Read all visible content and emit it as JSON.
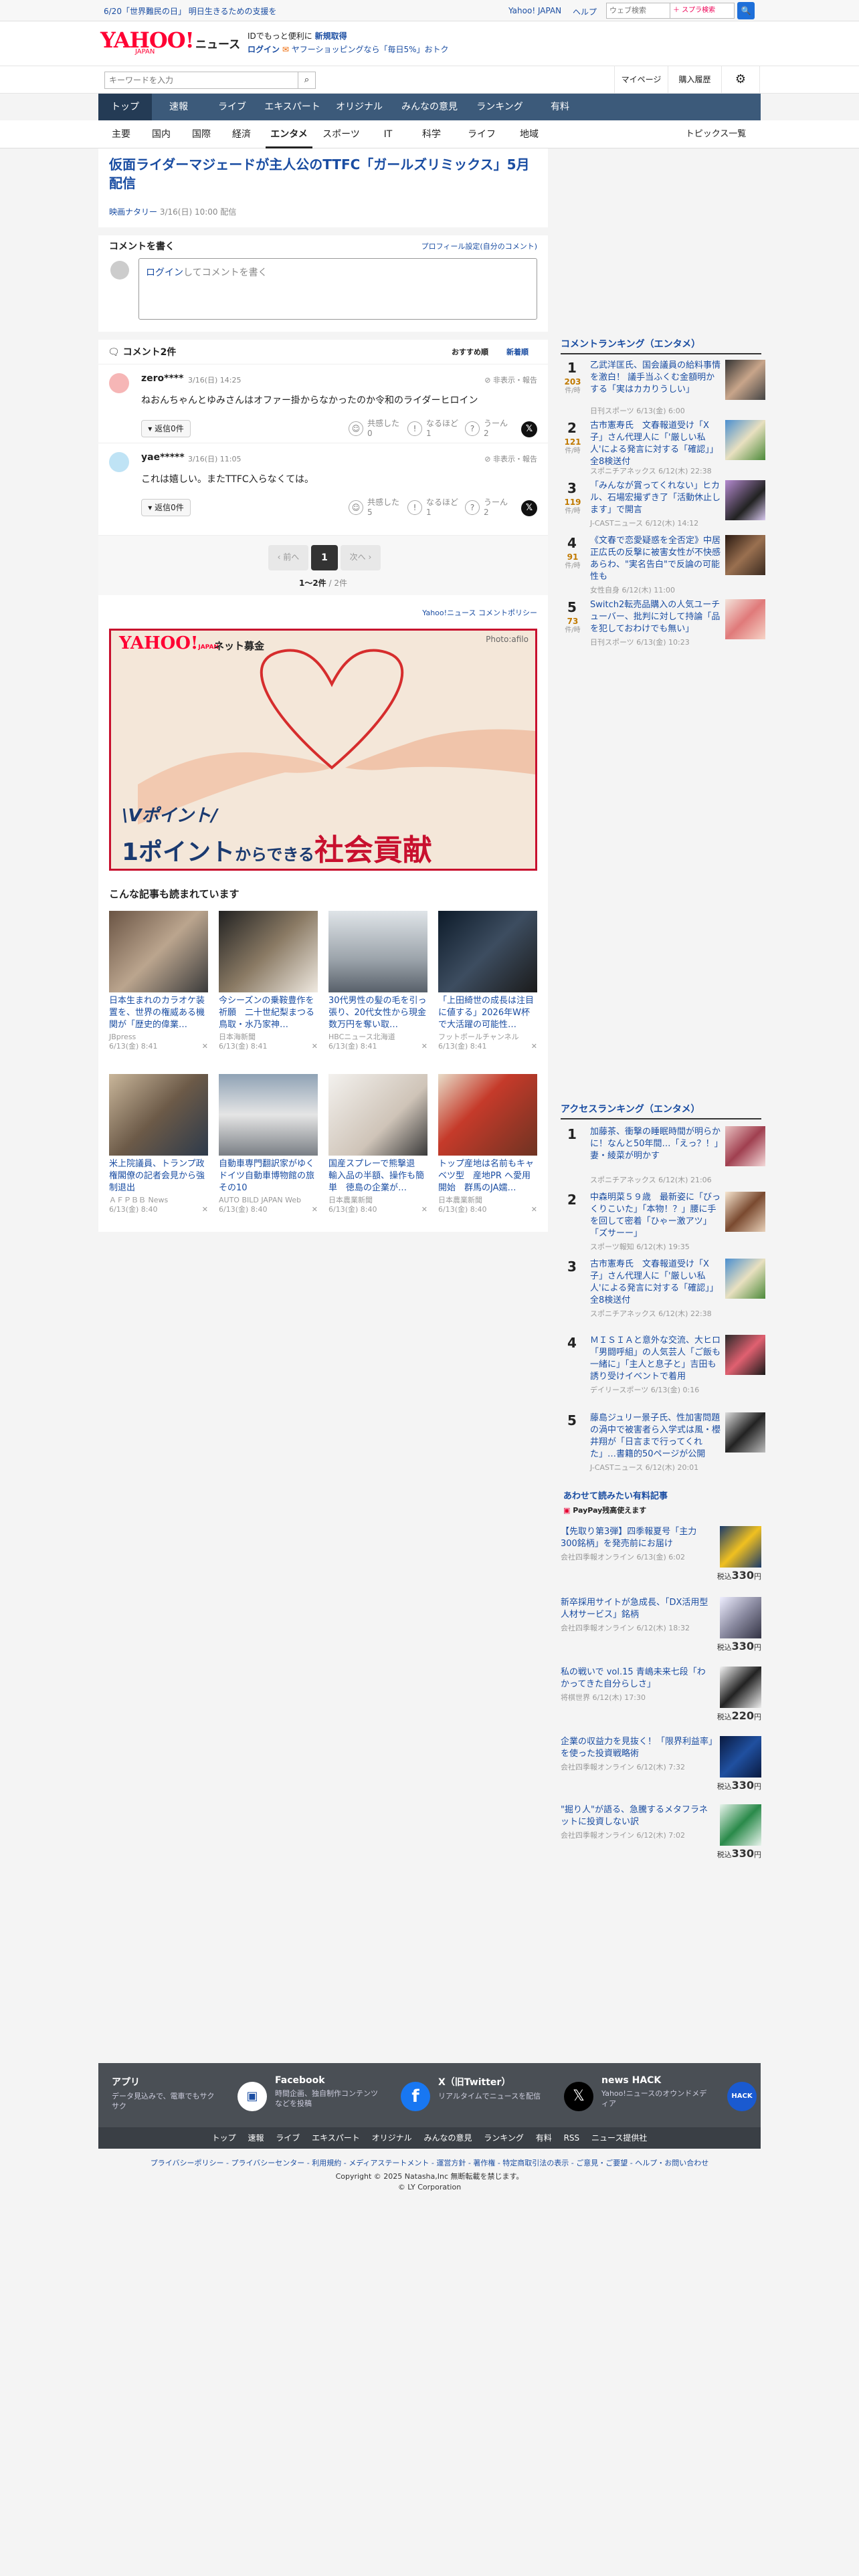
{
  "topbar": {
    "notice": "6/20「世界難民の日」 明日生きるための支援を",
    "yahoo_japan": "Yahoo! JAPAN",
    "help": "ヘルプ",
    "search_placeholder": "ウェブ検索",
    "search_btn": "🔍"
  },
  "header": {
    "logo": "YAHOO!",
    "logo_sub": "JAPAN",
    "service": "ニュース",
    "promo1": "IDでもっと便利に",
    "promo1b": "新規取得",
    "promo2a": "ログイン",
    "promo2b": "ヤフーショッピングなら「毎日5%」おトク"
  },
  "searchbar": {
    "placeholder": "キーワードを入力",
    "mypage": "マイページ",
    "history": "購入履歴"
  },
  "gnav": [
    "トップ",
    "速報",
    "ライブ",
    "エキスパート",
    "オリジナル",
    "みんなの意見",
    "ランキング",
    "有料"
  ],
  "subnav": [
    "主要",
    "国内",
    "国際",
    "経済",
    "エンタメ",
    "スポーツ",
    "IT",
    "科学",
    "ライフ",
    "地域"
  ],
  "subnav_right": "トピックス一覧",
  "article": {
    "title": "仮面ライダーマジェードが主人公のTTFC「ガールズリミックス」5月配信",
    "source": "映画ナタリー",
    "date": "3/16(日) 10:00 配信"
  },
  "comment_form": {
    "heading": "コメントを書く",
    "profile_link": "プロフィール設定(自分のコメント)",
    "login": "ログイン",
    "placeholder_rest": "してコメントを書く"
  },
  "comments": {
    "heading": "コメント2件",
    "sort1": "おすすめ順",
    "sort2": "新着順",
    "items": [
      {
        "user": "zero****",
        "date": "3/16(日) 14:25",
        "hide": "非表示・報告",
        "text": "ねおんちゃんとゆみさんはオファー掛からなかったのか令和のライダーヒロイン",
        "reply": "返信0件",
        "empathy": "共感した",
        "empathy_n": "0",
        "naruhodo": "なるほど",
        "naruhodo_n": "1",
        "uun": "うーん",
        "uun_n": "2"
      },
      {
        "user": "yae*****",
        "date": "3/16(日) 11:05",
        "hide": "非表示・報告",
        "text": "これは嬉しい。またTTFC入らなくては。",
        "reply": "返信0件",
        "empathy": "共感した",
        "empathy_n": "5",
        "naruhodo": "なるほど",
        "naruhodo_n": "1",
        "uun": "うーん",
        "uun_n": "2"
      }
    ],
    "prev": "前へ",
    "page": "1",
    "next": "次へ",
    "count": "1〜2件",
    "total": "/ 2件",
    "policy": "Yahoo!ニュース コメントポリシー"
  },
  "ad": {
    "logo": "YAHOO!",
    "logo_sub": "JAPAN",
    "label": "ネット募金",
    "photo": "Photo:afilo",
    "line1": "Vポイント/",
    "line2a": "1ポイント",
    "line2b": "からできる",
    "line2c": "社会貢献"
  },
  "related": {
    "heading": "こんな記事も読まれています",
    "items": [
      {
        "title": "日本生まれのカラオケ装置を、世界の権威ある機関が「歴史的偉業…",
        "src": "JBpress",
        "date": "6/13(金) 8:41"
      },
      {
        "title": "今シーズンの乗鞍豊作を祈願　二十世紀梨まつる鳥取・水乃家神…",
        "src": "日本海新聞",
        "date": "6/13(金) 8:41"
      },
      {
        "title": "30代男性の髪の毛を引っ張り、20代女性から現金数万円を奪い取…",
        "src": "HBCニュース北海道",
        "date": "6/13(金) 8:41"
      },
      {
        "title": "「上田綺世の成長は注目に値する」2026年W杯で大活躍の可能性…",
        "src": "フットボールチャンネル",
        "date": "6/13(金) 8:41"
      },
      {
        "title": "米上院議員、トランプ政権閣僚の記者会見から強制退出",
        "src": "ＡＦＰＢＢ News",
        "date": "6/13(金) 8:40"
      },
      {
        "title": "自動車専門翻訳家がゆくドイツ自動車博物館の旅　その10",
        "src": "AUTO BILD JAPAN Web",
        "date": "6/13(金) 8:40"
      },
      {
        "title": "国産スプレーで熊撃退　輸入品の半額、操作も簡単　徳島の企業が…",
        "src": "日本農業新聞",
        "date": "6/13(金) 8:40"
      },
      {
        "title": "トップ産地は名前もキャベツ型　産地PR へ愛用開始　群馬のJA嬬…",
        "src": "日本農業新聞",
        "date": "6/13(金) 8:40"
      }
    ]
  },
  "comment_ranking": {
    "heading": "コメントランキング（エンタメ）",
    "unit": "件/時",
    "items": [
      {
        "num": "1",
        "cnt": "203",
        "title": "乙武洋匡氏、国会議員の給料事情を激白！ 議手当ふくむ金額明かする「実はカカりうしい」",
        "src": "日刊スポーツ 6/13(金) 6:00"
      },
      {
        "num": "2",
        "cnt": "121",
        "title": "古市憲寿氏　文春報道受け「X子」さん代理人に「'厳しい私人'による発言に対する「確認」」全8検送付",
        "src": "スポニチアネックス 6/12(木) 22:38"
      },
      {
        "num": "3",
        "cnt": "119",
        "title": "「みんなが賞ってくれない」ヒカル、石場宏撮ずき了「活動休止します」で開言",
        "src": "J-CASTニュース 6/12(木) 14:12"
      },
      {
        "num": "4",
        "cnt": "91",
        "title": "《文春で恋愛疑惑を全否定》中居正広氏の反撃に被害女性が不快感あらわ、\"実名告白\"で反論の可能性も",
        "src": "女性自身 6/12(木) 11:00"
      },
      {
        "num": "5",
        "cnt": "73",
        "title": "Switch2転売品購入の人気ユーチューバー、批判に対して持論「品を犯しておわけでも無い」",
        "src": "日刊スポーツ 6/13(金) 10:23"
      }
    ]
  },
  "access_ranking": {
    "heading": "アクセスランキング（エンタメ）",
    "items": [
      {
        "num": "1",
        "title": "加藤茶、衝撃の睡眠時間が明らかに！なんと50年間…「えっ？！」妻・綾菜が明かす",
        "src": "スポニチアネックス 6/12(木) 21:06"
      },
      {
        "num": "2",
        "title": "中森明菜５９歳　最新姿に「びっくりこいた」「本物！？」腰に手を回して密着「ひゃー激アツ」「ズサーー」",
        "src": "スポーツ報知 6/12(木) 19:35"
      },
      {
        "num": "3",
        "title": "古市憲寿氏　文春報道受け「X子」さん代理人に「'厳しい私人'による発言に対する「確認」」全8検送付",
        "src": "スポニチアネックス 6/12(木) 22:38"
      },
      {
        "num": "4",
        "title": "ＭＩＳＩＡと意外な交流、大ヒロ「男闘呼組」の人気芸人「ご飯も一緒に」「主人と息子と」吉田も誘り受けイベントで着用",
        "src": "デイリースポーツ 6/13(金) 0:16"
      },
      {
        "num": "5",
        "title": "藤島ジュリー景子氏、性加害問題の渦中で被害者ら入学式は風・櫻井翔が「日言まで行ってくれた」…書籍的50ページが公開",
        "src": "J-CASTニュース 6/12(木) 20:01"
      }
    ]
  },
  "paid": {
    "heading": "あわせて読みたい有料記事",
    "paypay": "PayPay残高使えます",
    "items": [
      {
        "title": "【先取り第3弾】四季報夏号「主力300銘柄」を発売前にお届け",
        "src": "会社四季報オンライン 6/13(金) 6:02",
        "price": "330",
        "unit": "円",
        "tax": "税込"
      },
      {
        "title": "新卒採用サイトが急成長、「DX活用型人材サービス」銘柄",
        "src": "会社四季報オンライン 6/12(木) 18:32",
        "price": "330",
        "unit": "円",
        "tax": "税込"
      },
      {
        "title": "私の戦いで vol.15 青嶋未来七段「わかってきた自分らしさ」",
        "src": "将棋世界 6/12(木) 17:30",
        "price": "220",
        "unit": "円",
        "tax": "税込"
      },
      {
        "title": "企業の収益力を見抜く！「限界利益率」を使った投資戦略術",
        "src": "会社四季報オンライン 6/12(木) 7:32",
        "price": "330",
        "unit": "円",
        "tax": "税込"
      },
      {
        "title": "\"掘り人\"が語る、急騰するメタフラネットに投資しない訳",
        "src": "会社四季報オンライン 6/12(木) 7:02",
        "price": "330",
        "unit": "円",
        "tax": "税込"
      }
    ]
  },
  "footer": {
    "blocks": [
      {
        "h": "アプリ",
        "d": "データ見込みで、電車でもサクサク"
      },
      {
        "h": "Facebook",
        "d": "時間企画、独自制作コンテンツなどを投稿"
      },
      {
        "h": "X（旧Twitter）",
        "d": "リアルタイムでニュースを配信"
      },
      {
        "h": "news HACK",
        "d": "Yahoo!ニュースのオウンドメディア"
      }
    ],
    "links": [
      "トップ",
      "速報",
      "ライブ",
      "エキスパート",
      "オリジナル",
      "みんなの意見",
      "ランキング",
      "有料",
      "RSS",
      "ニュース提供社"
    ],
    "legal": "プライバシーポリシー - プライバシーセンター - 利用規約 - メディアステートメント - 運営方針 - 著作権 - 特定商取引法の表示 - ご意見・ご要望 - ヘルプ・お問い合わせ",
    "copy1": "Copyright © 2025 Natasha,Inc 無断転載を禁じます。",
    "copy2": "© LY Corporation"
  },
  "colors": {
    "accent": "#1a4da2",
    "gnav": "#3c5a7a",
    "rank_count": "#c17a00",
    "ad_red": "#c8102e"
  }
}
